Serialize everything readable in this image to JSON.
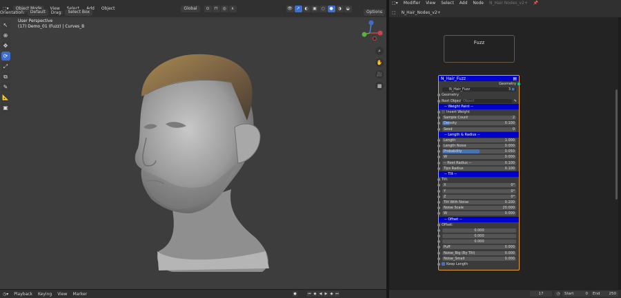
{
  "viewport_header": {
    "mode": "Object Mode",
    "menus": [
      "View",
      "Select",
      "Add",
      "Object"
    ],
    "orientation_label": "Orientation:",
    "orientation_value": "Default",
    "drag_label": "Drag:",
    "drag_value": "Select Box",
    "transform": "Global",
    "options": "Options"
  },
  "viewport_info": {
    "line1": "User Perspective",
    "line2": "(17) Demo_01 (Fuzz) | Curves_B"
  },
  "node_editor_header": {
    "editor": "Modifier",
    "menus": [
      "View",
      "Select",
      "Add",
      "Node"
    ],
    "node_group": "N_Hair Nodes_v2+",
    "breadcrumb": "N_Hair_Nodes_v2+"
  },
  "frame_label": "Fuzz",
  "node": {
    "title": "N_Hair_Fuzz",
    "output": "Geometry",
    "group_name": "N_Hair_Fuzz",
    "group_users": "3",
    "rows": [
      {
        "type": "label",
        "label": "Geometry"
      },
      {
        "type": "object",
        "label": "Root Object:",
        "placeholder": "Object"
      },
      {
        "type": "panel",
        "label": "-- Weight Paint --"
      },
      {
        "type": "check",
        "label": "Invert Weight",
        "checked": false
      },
      {
        "type": "value",
        "label": "Sample Count",
        "value": "2"
      },
      {
        "type": "value",
        "label": "Density",
        "value": "0.100",
        "fill": 0.1
      },
      {
        "type": "value",
        "label": "Seed",
        "value": "0"
      },
      {
        "type": "panel",
        "label": "-- Length & Radius --"
      },
      {
        "type": "value",
        "label": "Length",
        "value": "1.000"
      },
      {
        "type": "value",
        "label": "Length Noise",
        "value": "0.000"
      },
      {
        "type": "value",
        "label": "Probability",
        "value": "0.050",
        "fill": 0.5
      },
      {
        "type": "value",
        "label": "W",
        "value": "0.000"
      },
      {
        "type": "value",
        "label": "-- Root Radius --",
        "value": "0.100"
      },
      {
        "type": "value",
        "label": "Tips Radius",
        "value": "0.100"
      },
      {
        "type": "panel",
        "label": "-- Tilt --"
      },
      {
        "type": "label",
        "label": "Tilt:"
      },
      {
        "type": "value",
        "label": "X",
        "value": "0°"
      },
      {
        "type": "value",
        "label": "Y",
        "value": "0°"
      },
      {
        "type": "value",
        "label": "Z",
        "value": "0°"
      },
      {
        "type": "value",
        "label": "Tilt With Noise",
        "value": "0.200"
      },
      {
        "type": "value",
        "label": "Noise Scale",
        "value": "20.000"
      },
      {
        "type": "value",
        "label": "W",
        "value": "0.000"
      },
      {
        "type": "panel",
        "label": "-- Offset --"
      },
      {
        "type": "label",
        "label": "Offset:"
      },
      {
        "type": "value",
        "label": "",
        "value": "0.000",
        "center": true
      },
      {
        "type": "value",
        "label": "",
        "value": "0.000",
        "center": true
      },
      {
        "type": "value",
        "label": "",
        "value": "0.000",
        "center": true
      },
      {
        "type": "value",
        "label": "Puff",
        "value": "0.000"
      },
      {
        "type": "value",
        "label": "Noise_Big (By Tilt)",
        "value": "0.000"
      },
      {
        "type": "value",
        "label": "Noise_Small",
        "value": "0.000"
      },
      {
        "type": "check",
        "label": "Keep Length",
        "checked": true
      }
    ]
  },
  "timeline": {
    "menus": [
      "Playback",
      "Keying",
      "View",
      "Marker"
    ],
    "current_frame": "17",
    "start_label": "Start",
    "start": "0",
    "end_label": "End",
    "end": "250"
  },
  "colors": {
    "accent": "#3d6fd1",
    "node_header": "#0000cc",
    "node_border": "#e8a040"
  }
}
